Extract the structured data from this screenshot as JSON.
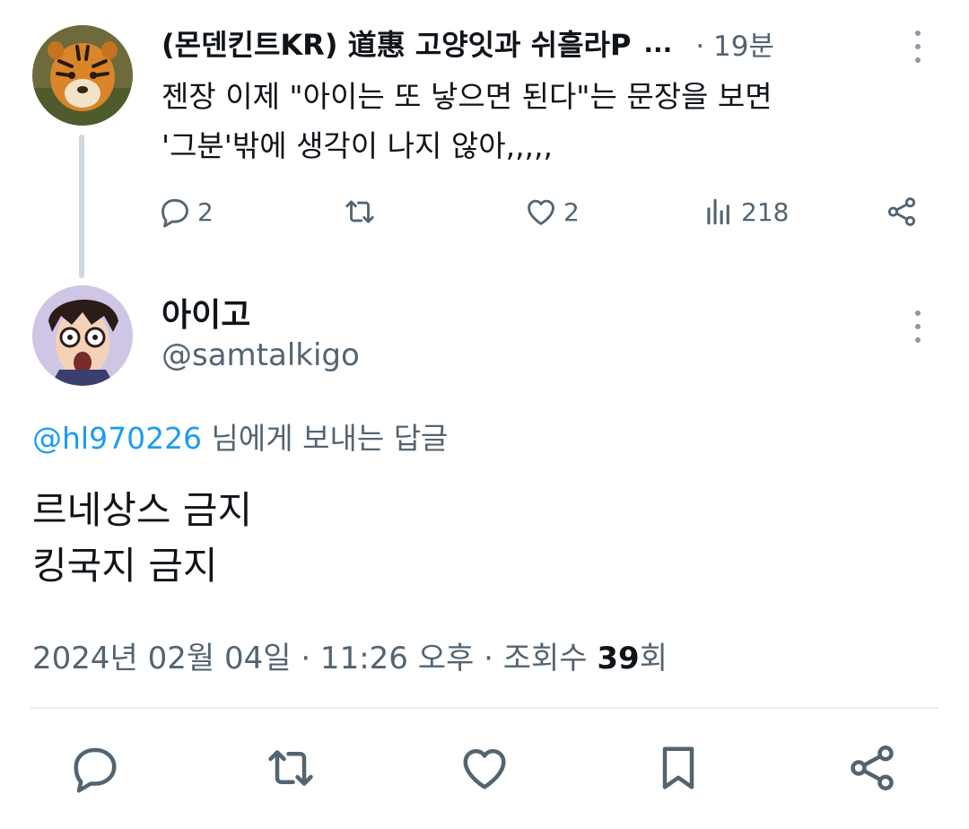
{
  "parent_tweet": {
    "display_name": "(몬덴킨트KR) 道惠 고양잇과 쉬흘라P",
    "ellipsis": "...",
    "time": "· 19분",
    "text_line1": "젠장 이제 \"아이는 또 낳으면 된다\"는 문장을 보면",
    "text_line2": "'그분'밖에 생각이 나지 않아,,,,,",
    "avatar_icon": "tiger-avatar",
    "actions": {
      "reply_count": "2",
      "like_count": "2",
      "views_count": "218"
    }
  },
  "reply_tweet": {
    "display_name": "아이고",
    "handle": "@samtalkigo",
    "avatar_icon": "anime-character-avatar",
    "reply_to_mention": "@hl970226",
    "reply_to_suffix": " 님에게 보내는 답글",
    "body_line1": "르네상스 금지",
    "body_line2": "킹국지 금지",
    "meta_prefix": "2024년 02월 04일 · 11:26 오후 · 조회수 ",
    "views_number": "39",
    "views_suffix": "회"
  },
  "colors": {
    "text_primary": "#0f1419",
    "text_secondary": "#536471",
    "link": "#1d9bf0",
    "divider": "#e6ecf0",
    "thread_line": "#cfd9de"
  }
}
